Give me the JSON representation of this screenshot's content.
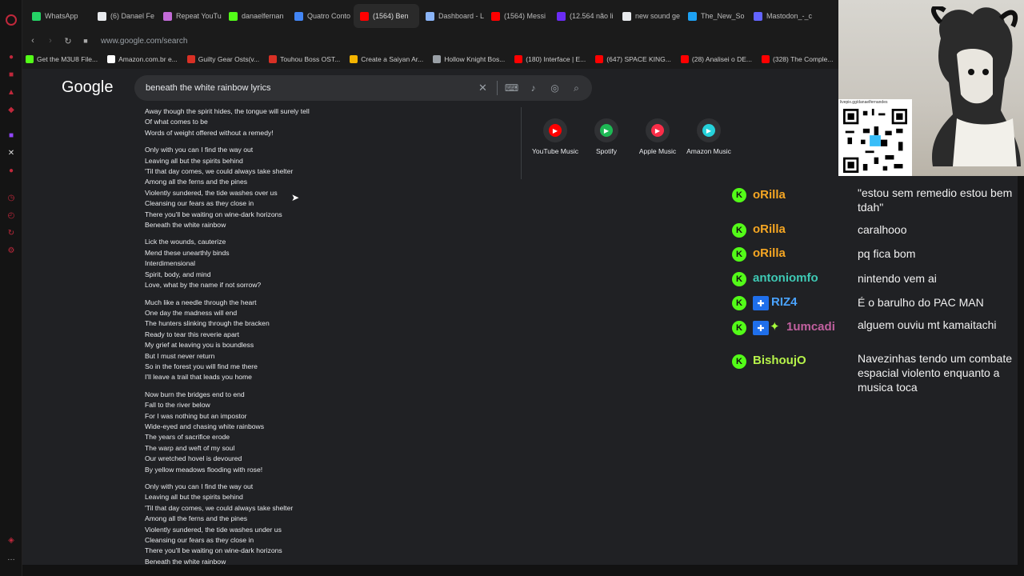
{
  "browser": {
    "tabs": [
      {
        "label": "WhatsApp",
        "color": "#25d366",
        "active": false
      },
      {
        "label": "(6) Danael Fe",
        "color": "#e8eaed",
        "active": false
      },
      {
        "label": "Repeat YouTu",
        "color": "#c26bd7",
        "active": false
      },
      {
        "label": "danaelfernan",
        "color": "#53fc18",
        "active": false
      },
      {
        "label": "Quatro Conto",
        "color": "#4285f4",
        "active": false
      },
      {
        "label": "(1564) Ben",
        "color": "#ff0000",
        "active": true
      },
      {
        "label": "Dashboard - L",
        "color": "#8ab4f8",
        "active": false
      },
      {
        "label": "(1564) Messi",
        "color": "#ff0000",
        "active": false
      },
      {
        "label": "(12.564 não li",
        "color": "#6b2cf5",
        "active": false
      },
      {
        "label": "new sound ge",
        "color": "#e8eaed",
        "active": false
      },
      {
        "label": "The_New_So",
        "color": "#1da1f2",
        "active": false
      },
      {
        "label": "Mastodon_-_c",
        "color": "#6364ff",
        "active": false
      }
    ],
    "url": "www.google.com/search",
    "bookmarks": [
      {
        "label": "Get the M3U8 File...",
        "color": "#53fc18"
      },
      {
        "label": "Amazon.com.br e...",
        "color": "#ffffff"
      },
      {
        "label": "Guilty Gear Osts(v...",
        "color": "#d93025"
      },
      {
        "label": "Touhou Boss OST...",
        "color": "#d93025"
      },
      {
        "label": "Create a Saiyan Ar...",
        "color": "#f4b400"
      },
      {
        "label": "Hollow Knight Bos...",
        "color": "#9aa0a6"
      },
      {
        "label": "(180) Interface | E...",
        "color": "#ff0000"
      },
      {
        "label": "(647) SPACE KING...",
        "color": "#ff0000"
      },
      {
        "label": "(28) Analisei o DE...",
        "color": "#ff0000"
      },
      {
        "label": "(328) The Comple...",
        "color": "#ff0000"
      }
    ]
  },
  "google": {
    "logo": "Google",
    "query": "beneath the white rainbow lyrics",
    "lyrics": [
      [
        "Away though the spirit hides, the tongue will surely tell",
        "Of what comes to be",
        "Words of weight offered without a remedy!"
      ],
      [
        "Only with you can I find the way out",
        "Leaving all but the spirits behind",
        "'Til that day comes, we could always take shelter",
        "Among all the ferns and the pines",
        "Violently sundered, the tide washes over us",
        "Cleansing our fears as they close in",
        "There you'll be waiting on wine-dark horizons",
        "Beneath the white rainbow"
      ],
      [
        "Lick the wounds, cauterize",
        "Mend these unearthly binds",
        "Interdimensional",
        "Spirit, body, and mind",
        "Love, what by the name if not sorrow?"
      ],
      [
        "Much like a needle through the heart",
        "One day the madness will end",
        "The hunters slinking through the bracken",
        "Ready to tear this reverie apart",
        "My grief at leaving you is boundless",
        "But I must never return",
        "So in the forest you will find me there",
        "I'll leave a trail that leads you home"
      ],
      [
        "Now burn the bridges end to end",
        "Fall to the river below",
        "For I was nothing but an impostor",
        "Wide-eyed and chasing white rainbows",
        "The years of sacrifice erode",
        "The warp and weft of my soul",
        "Our wretched hovel is devoured",
        "By yellow meadows flooding with rose!"
      ],
      [
        "Only with you can I find the way out",
        "Leaving all but the spirits behind",
        "'Til that day comes, we could always take shelter",
        "Among all the ferns and the pines",
        "Violently sundered, the tide washes under us",
        "Cleansing our fears as they close in",
        "There you'll be waiting on wine-dark horizons",
        "Beneath the white rainbow"
      ]
    ],
    "services": [
      {
        "label": "YouTube Music",
        "color": "#ff0000",
        "icon": "youtube-music-icon"
      },
      {
        "label": "Spotify",
        "color": "#1db954",
        "icon": "spotify-icon"
      },
      {
        "label": "Apple Music",
        "color": "#fa2d48",
        "icon": "apple-music-icon"
      },
      {
        "label": "Amazon Music",
        "color": "#25d1da",
        "icon": "amazon-music-icon"
      }
    ]
  },
  "chat": {
    "messages": [
      {
        "user": "oRilla",
        "color": "#f5a623",
        "text": "\"estou sem remedio estou bem tdah\"",
        "mod": false
      },
      {
        "user": "oRilla",
        "color": "#f5a623",
        "text": "caralhooo",
        "mod": false
      },
      {
        "user": "oRilla",
        "color": "#f5a623",
        "text": "pq fica bom",
        "mod": false
      },
      {
        "user": "antoniomfo",
        "color": "#3ec9b4",
        "text": "nintendo vem ai",
        "mod": false
      },
      {
        "user": "RIZ4",
        "color": "#4aa3ff",
        "text": "É o barulho do PAC MAN",
        "mod": true
      },
      {
        "user": "1umcadi",
        "color": "#c1609f",
        "text": "alguem ouviu mt kamaitachi",
        "mod": true
      },
      {
        "user": "BishoujO",
        "color": "#b6f34a",
        "text": "Navezinhas tendo um combate espacial violento enquanto a musica toca",
        "mod": false
      }
    ]
  },
  "overlay": {
    "qr_caption": "livepix.gg/danaelfernandes"
  }
}
